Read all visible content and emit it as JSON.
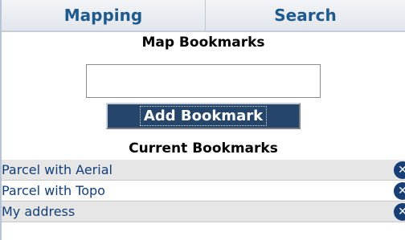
{
  "tabs": {
    "mapping": "Mapping",
    "search": "Search"
  },
  "map_bookmarks": {
    "title": "Map Bookmarks",
    "input_value": "",
    "add_button_label": "Add Bookmark"
  },
  "current_bookmarks": {
    "title": "Current Bookmarks",
    "items": [
      {
        "label": "Parcel with Aerial",
        "delete_icon": "close-icon"
      },
      {
        "label": "Parcel with Topo",
        "delete_icon": "close-icon"
      },
      {
        "label": "My address",
        "delete_icon": "close-icon"
      }
    ]
  },
  "colors": {
    "tab_text": "#1f5a8c",
    "button_bg": "#26456a",
    "link_text": "#123f78",
    "row_alt_bg": "#e6e6e6",
    "delete_icon_bg": "#173f76"
  }
}
